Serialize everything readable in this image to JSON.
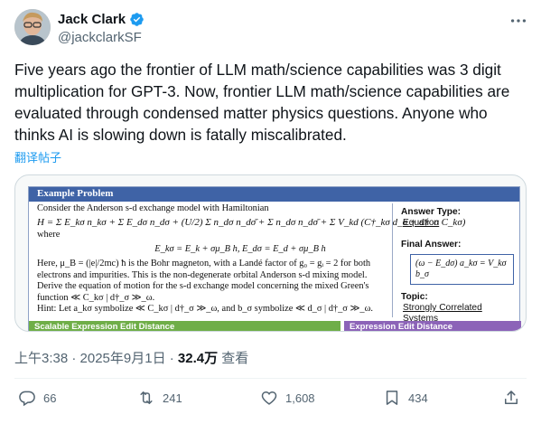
{
  "author": {
    "name": "Jack Clark",
    "handle": "@jackclarkSF"
  },
  "tweet": {
    "text": "Five years ago the frontier of LLM math/science capabilities was 3 digit\nmultiplication for GPT-3. Now, frontier LLM math/science capabilities are\nevaluated through condensed matter physics questions. Anyone who\nthinks AI is slowing down is fatally miscalibrated.",
    "translate_label": "翻译帖子"
  },
  "media": {
    "title": "Example Problem",
    "line1": "Consider the Anderson s-d exchange model with Hamiltonian",
    "hamiltonian": "H = Σ E_kσ n_kσ + Σ E_dσ n_dσ + (U/2) Σ n_dσ n_dσ̄ + Σ n_dσ n_dσ̄ + Σ V_kd (C†_kσ d_σ + d†_σ C_kσ)",
    "where": "where",
    "energies": "E_kσ = E_k + σμ_B h,   E_dσ = E_d + σμ_B h",
    "line_here": "Here, μ_B = (|e|/2mc) ħ is the Bohr magneton, with a Landé factor of g₀ = gᵢ = 2 for both",
    "line_electrons": "electrons and impurities. This is the non-degenerate orbital Anderson s-d mixing model.",
    "line_derive": "Derive the equation of motion for the s-d exchange model concerning the mixed Green's",
    "line_function": "function ≪ C_kσ | d†_σ ≫_ω.",
    "line_hint": "Hint: Let a_kσ symbolize ≪ C_kσ | d†_σ ≫_ω, and b_σ symbolize ≪ d_σ | d†_σ ≫_ω.",
    "answer_type_label": "Answer Type:",
    "answer_type_value": "Equation",
    "final_answer_label": "Final Answer:",
    "final_answer_value": "(ω − E_dσ) a_kσ = V_kσ b_σ",
    "topic_label": "Topic:",
    "topic_value": "Strongly Correlated Systems",
    "band_left": "Scalable Expression Edit Distance",
    "band_right": "Expression Edit Distance"
  },
  "meta": {
    "time_date": "上午3:38 · 2025年9月1日 · ",
    "views": "32.4万",
    "views_label": " 查看"
  },
  "actions": {
    "replies": "66",
    "reposts": "241",
    "likes": "1,608",
    "bookmarks": "434"
  }
}
